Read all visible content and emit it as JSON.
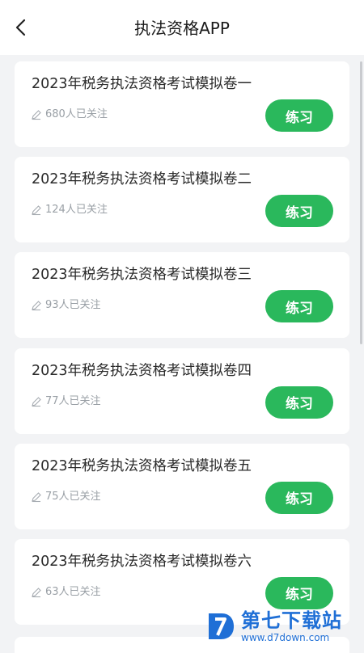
{
  "header": {
    "title": "执法资格APP",
    "back_icon": "chevron-left-icon"
  },
  "exams": [
    {
      "title": "2023年税务执法资格考试模拟卷一",
      "followers": "680人已关注",
      "button": "练习"
    },
    {
      "title": "2023年税务执法资格考试模拟卷二",
      "followers": "124人已关注",
      "button": "练习"
    },
    {
      "title": "2023年税务执法资格考试模拟卷三",
      "followers": "93人已关注",
      "button": "练习"
    },
    {
      "title": "2023年税务执法资格考试模拟卷四",
      "followers": "77人已关注",
      "button": "练习"
    },
    {
      "title": "2023年税务执法资格考试模拟卷五",
      "followers": "75人已关注",
      "button": "练习"
    },
    {
      "title": "2023年税务执法资格考试模拟卷六",
      "followers": "63人已关注",
      "button": "练习"
    }
  ],
  "meta_icon": "pen-icon",
  "colors": {
    "accent": "#2ab85c",
    "background": "#f2f3f5",
    "muted_text": "#9aa0a6",
    "watermark": "#1f6fd6"
  },
  "watermark": {
    "brand": "第七下载站",
    "url": "www.d7down.com"
  }
}
